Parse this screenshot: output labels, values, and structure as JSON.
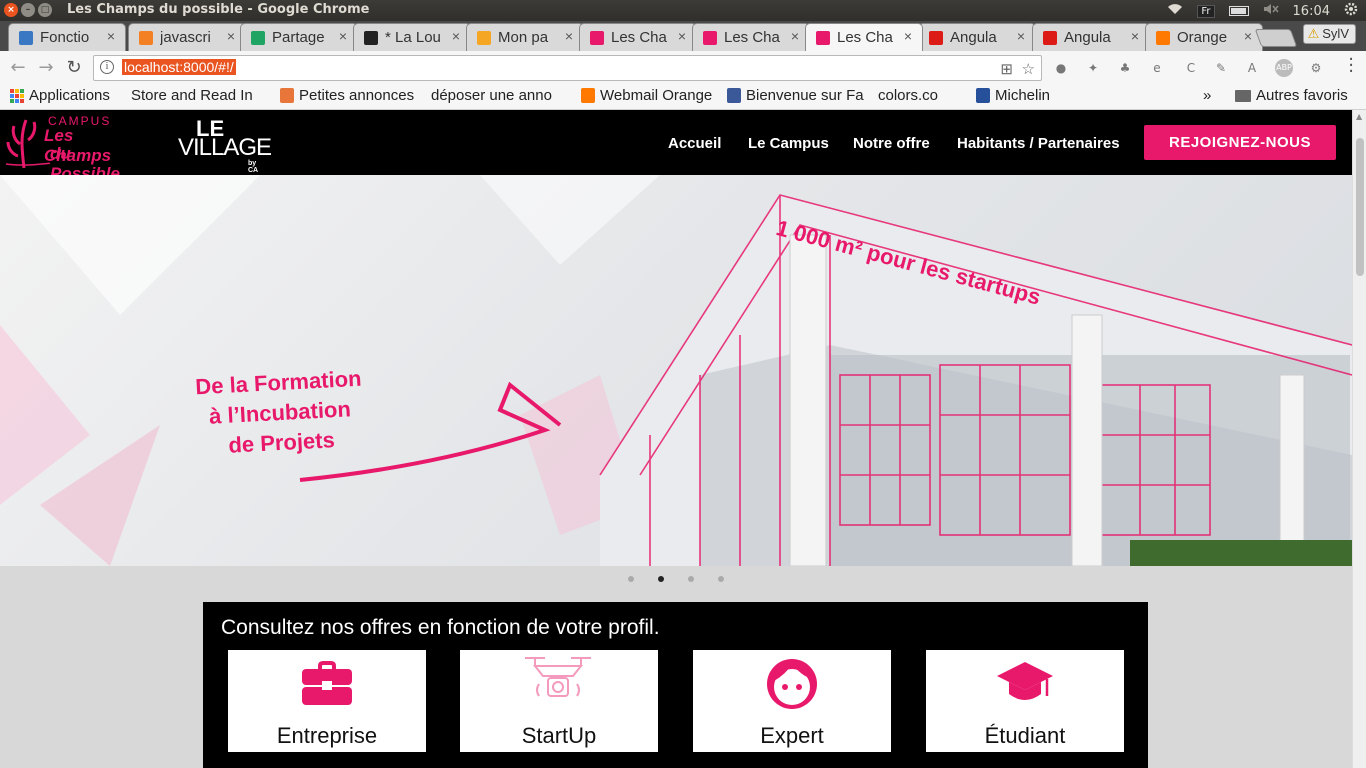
{
  "os": {
    "window_title": "Les Champs du possible - Google Chrome",
    "keyboard": "Fr",
    "clock": "16:04",
    "close_glyph": "×",
    "min_glyph": "–",
    "max_glyph": "□"
  },
  "tabs": [
    {
      "label": "Fonctio",
      "favicon_color": "#3b78c4"
    },
    {
      "label": "javascri",
      "favicon_color": "#f48024"
    },
    {
      "label": "Partage",
      "favicon_color": "#1fa463"
    },
    {
      "label": "* La Lou",
      "favicon_color": "#222222"
    },
    {
      "label": "Mon pa",
      "favicon_color": "#f5a623"
    },
    {
      "label": "Les Cha",
      "favicon_color": "#e8196b"
    },
    {
      "label": "Les Cha",
      "favicon_color": "#e8196b"
    },
    {
      "label": "Les Cha",
      "favicon_color": "#e8196b",
      "active": true
    },
    {
      "label": "Angula",
      "favicon_color": "#dd1b16"
    },
    {
      "label": "Angula",
      "favicon_color": "#dd1b16"
    },
    {
      "label": "Orange",
      "favicon_color": "#ff7900"
    }
  ],
  "tab_close_glyph": "×",
  "profile_name": "SylV",
  "address": {
    "url": "localhost:8000/#!/",
    "info_glyph": "i",
    "translate_glyph": "⊞",
    "star_glyph": "☆"
  },
  "nav_glyphs": {
    "back": "←",
    "forward": "→",
    "reload": "↻"
  },
  "extensions": [
    "●",
    "✦",
    "♣",
    "e",
    "C",
    "✎",
    "A",
    "ABP",
    "⚙"
  ],
  "bookmarks": [
    {
      "label": "Applications",
      "icon": "apps-grid-icon"
    },
    {
      "label": "Store and Read In",
      "icon": "page-icon"
    },
    {
      "label": "Petites annonces",
      "icon": "box-icon"
    },
    {
      "label": "déposer une anno",
      "icon": "page-icon"
    },
    {
      "label": "Webmail Orange",
      "icon": "orange-icon"
    },
    {
      "label": "Bienvenue sur Fa",
      "icon": "facebook-icon"
    },
    {
      "label": "colors.co",
      "icon": "page-icon"
    },
    {
      "label": "Michelin",
      "icon": "michelin-icon"
    }
  ],
  "bookmarks_overflow": "»",
  "other_bookmarks": "Autres favoris",
  "site": {
    "logo_campus": {
      "small": "CAMPUS",
      "line1": "Les Champs",
      "line2": "du Possible"
    },
    "logo_village": {
      "le": "LE",
      "village": "VILLAGE",
      "by": "by CA"
    },
    "nav": [
      {
        "label": "Accueil"
      },
      {
        "label": "Le Campus"
      },
      {
        "label": "Notre offre"
      },
      {
        "label": "Habitants / Partenaires"
      }
    ],
    "cta": "REJOIGNEZ-NOUS",
    "accent": "#e8196b"
  },
  "hero": {
    "tagline": [
      "De la Formation",
      "à l’Incubation",
      "de Projets"
    ],
    "banner": "1 000 m² pour les startups",
    "slides": 4,
    "active_slide": 2
  },
  "offers": {
    "title": "Consultez nos offres en fonction de votre profil.",
    "cards": [
      {
        "label": "Entreprise",
        "icon": "briefcase-icon"
      },
      {
        "label": "StartUp",
        "icon": "drone-icon"
      },
      {
        "label": "Expert",
        "icon": "face-icon"
      },
      {
        "label": "Étudiant",
        "icon": "graduation-cap-icon"
      }
    ]
  }
}
